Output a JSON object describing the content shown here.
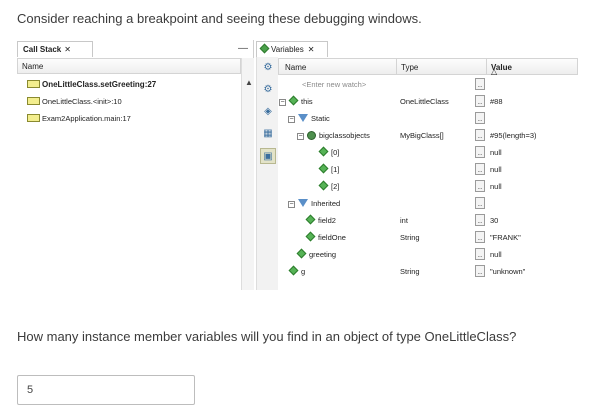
{
  "intro_text": "Consider reaching a breakpoint and seeing these debugging windows.",
  "question_text": "How many instance member variables will you find in an object of type OneLittleClass?",
  "answer_value": "5",
  "call_stack": {
    "tab_label": "Call Stack",
    "close_glyph": "✕",
    "minimize_glyph": "—",
    "column_header": "Name",
    "frames": [
      "OneLittleClass.setGreeting:27",
      "OneLittleClass.<init>:10",
      "Exam2Application.main:17"
    ]
  },
  "variables": {
    "tab_label": "Variables",
    "close_glyph": "✕",
    "headers": {
      "name": "Name",
      "type": "Type",
      "value": "Value",
      "sort_glyph": "△"
    },
    "dots_glyph": "...",
    "rows": [
      {
        "name": "<Enter new watch>",
        "type": "",
        "value": ""
      },
      {
        "name": "this",
        "type": "OneLittleClass",
        "value": "#88"
      },
      {
        "name": "Static",
        "type": "",
        "value": ""
      },
      {
        "name": "bigclassobjects",
        "type": "MyBigClass[]",
        "value": "#95(length=3)"
      },
      {
        "name": "[0]",
        "type": "",
        "value": "null"
      },
      {
        "name": "[1]",
        "type": "",
        "value": "null"
      },
      {
        "name": "[2]",
        "type": "",
        "value": "null"
      },
      {
        "name": "Inherited",
        "type": "",
        "value": ""
      },
      {
        "name": "field2",
        "type": "int",
        "value": "30"
      },
      {
        "name": "fieldOne",
        "type": "String",
        "value": "\"FRANK\""
      },
      {
        "name": "greeting",
        "type": "",
        "value": "null"
      },
      {
        "name": "g",
        "type": "String",
        "value": "\"unknown\""
      }
    ]
  }
}
